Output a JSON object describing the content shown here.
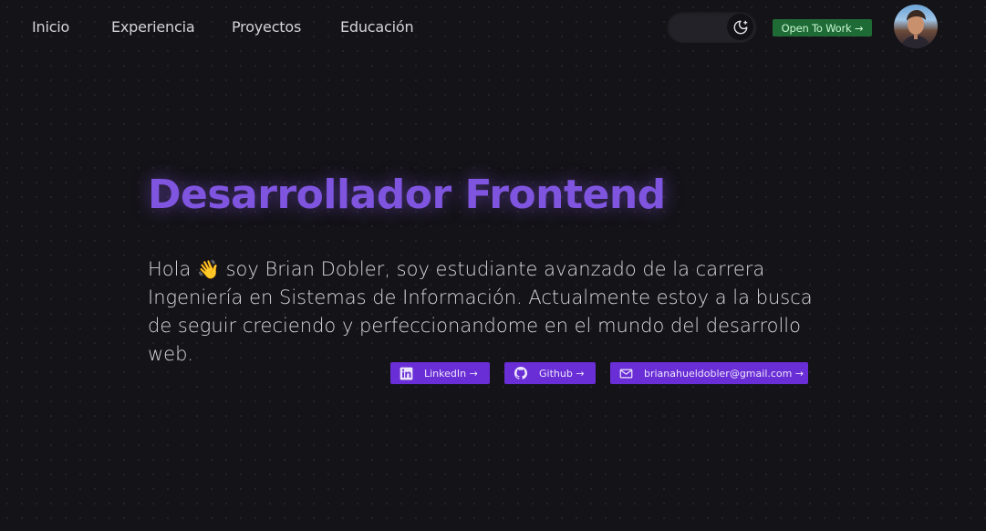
{
  "nav": {
    "items": [
      {
        "label": "Inicio"
      },
      {
        "label": "Experiencia"
      },
      {
        "label": "Proyectos"
      },
      {
        "label": "Educación"
      }
    ],
    "open_to_work": "Open To Work →",
    "theme_icon": "moon-sparkle-icon"
  },
  "hero": {
    "title": "Desarrollador Frontend",
    "intro_before_emoji": "Hola",
    "emoji": "👋",
    "intro_after_emoji": " soy Brian Dobler, soy estudiante avanzado de la carrera Ingeniería en Sistemas de Información. Actualmente estoy a la busca de seguir creciendo y perfeccionandome en el mundo del desarrollo web."
  },
  "social": {
    "linkedin": "LinkedIn →",
    "github": "Github →",
    "email": "brianahueldobler@gmail.com →"
  },
  "colors": {
    "background": "#141318",
    "accent": "#7f54df",
    "button": "#6a2ed6",
    "open_to_work": "#1f6b35"
  }
}
